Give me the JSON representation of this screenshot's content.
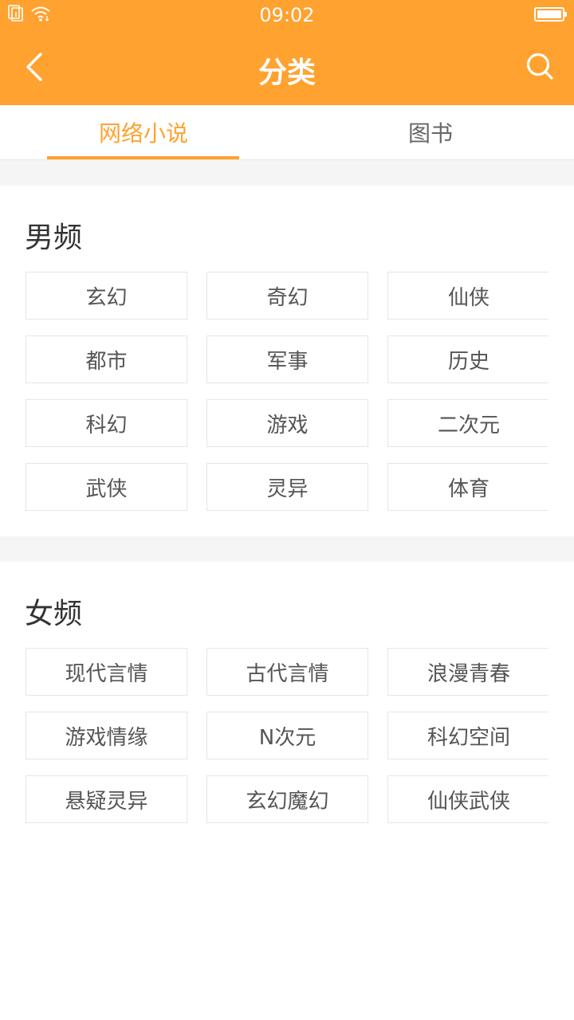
{
  "status_bar": {
    "time": "09:02"
  },
  "app_bar": {
    "title": "分类"
  },
  "tabs": [
    {
      "label": "网络小说",
      "active": true
    },
    {
      "label": "图书",
      "active": false
    }
  ],
  "sections": {
    "male": {
      "title": "男频",
      "rows": [
        [
          "玄幻",
          "奇幻",
          "仙侠"
        ],
        [
          "都市",
          "军事",
          "历史"
        ],
        [
          "科幻",
          "游戏",
          "二次元"
        ],
        [
          "武侠",
          "灵异",
          "体育"
        ]
      ]
    },
    "female": {
      "title": "女频",
      "rows": [
        [
          "现代言情",
          "古代言情",
          "浪漫青春"
        ],
        [
          "游戏情缘",
          "N次元",
          "科幻空间"
        ],
        [
          "悬疑灵异",
          "玄幻魔幻",
          "仙侠武侠"
        ]
      ]
    }
  },
  "colors": {
    "accent": "#FFA230",
    "background_gray": "#f5f5f5",
    "border": "#e6e6e6",
    "text": "#555555"
  },
  "icons": [
    "sim-card-icon",
    "wifi-icon",
    "battery-icon",
    "back-arrow-icon",
    "search-icon"
  ]
}
